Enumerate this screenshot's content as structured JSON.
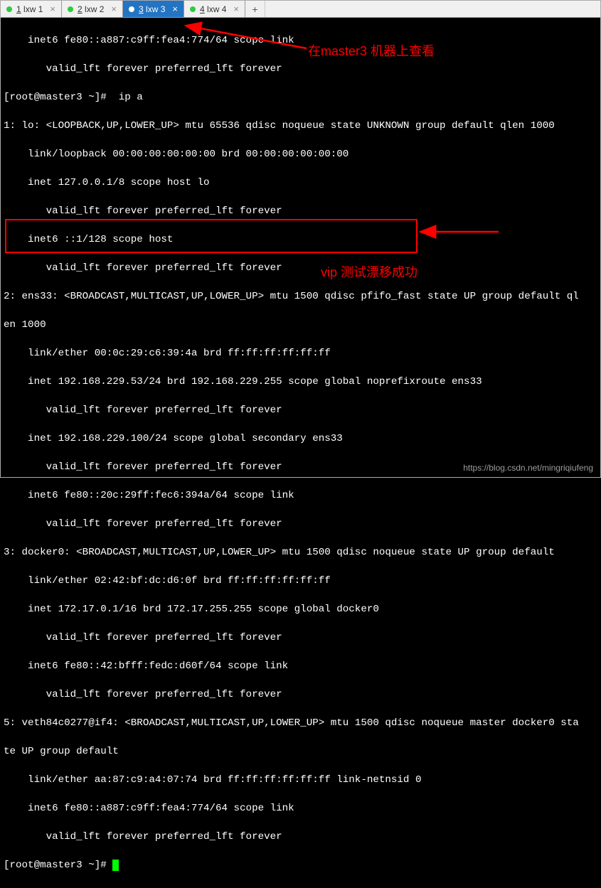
{
  "tabs": [
    {
      "num": "1",
      "label": "lxw 1"
    },
    {
      "num": "2",
      "label": "lxw 2"
    },
    {
      "num": "3",
      "label": "lxw 3"
    },
    {
      "num": "4",
      "label": "lxw 4"
    }
  ],
  "activeTabIndex": 2,
  "terminal": {
    "l0": "    inet6 fe80::a887:c9ff:fea4:774/64 scope link",
    "l1": "       valid_lft forever preferred_lft forever",
    "l2": "[root@master3 ~]#  ip a",
    "l3": "1: lo: <LOOPBACK,UP,LOWER_UP> mtu 65536 qdisc noqueue state UNKNOWN group default qlen 1000",
    "l4": "    link/loopback 00:00:00:00:00:00 brd 00:00:00:00:00:00",
    "l5": "    inet 127.0.0.1/8 scope host lo",
    "l6": "       valid_lft forever preferred_lft forever",
    "l7": "    inet6 ::1/128 scope host",
    "l8": "       valid_lft forever preferred_lft forever",
    "l9": "2: ens33: <BROADCAST,MULTICAST,UP,LOWER_UP> mtu 1500 qdisc pfifo_fast state UP group default ql",
    "l10": "en 1000",
    "l11": "    link/ether 00:0c:29:c6:39:4a brd ff:ff:ff:ff:ff:ff",
    "l12": "    inet 192.168.229.53/24 brd 192.168.229.255 scope global noprefixroute ens33",
    "l13": "       valid_lft forever preferred_lft forever",
    "l14": "    inet 192.168.229.100/24 scope global secondary ens33",
    "l15": "       valid_lft forever preferred_lft forever",
    "l16": "    inet6 fe80::20c:29ff:fec6:394a/64 scope link",
    "l17": "       valid_lft forever preferred_lft forever",
    "l18": "3: docker0: <BROADCAST,MULTICAST,UP,LOWER_UP> mtu 1500 qdisc noqueue state UP group default",
    "l19": "    link/ether 02:42:bf:dc:d6:0f brd ff:ff:ff:ff:ff:ff",
    "l20": "    inet 172.17.0.1/16 brd 172.17.255.255 scope global docker0",
    "l21": "       valid_lft forever preferred_lft forever",
    "l22": "    inet6 fe80::42:bfff:fedc:d60f/64 scope link",
    "l23": "       valid_lft forever preferred_lft forever",
    "l24": "5: veth84c0277@if4: <BROADCAST,MULTICAST,UP,LOWER_UP> mtu 1500 qdisc noqueue master docker0 sta",
    "l25": "te UP group default",
    "l26": "    link/ether aa:87:c9:a4:07:74 brd ff:ff:ff:ff:ff:ff link-netnsid 0",
    "l27": "    inet6 fe80::a887:c9ff:fea4:774/64 scope link",
    "l28": "       valid_lft forever preferred_lft forever",
    "l29": "[root@master3 ~]# "
  },
  "annotations": {
    "top": "在master3 机器上查看",
    "mid": "vip 测试漂移成功"
  },
  "watermark": "https://blog.csdn.net/mingriqiufeng"
}
